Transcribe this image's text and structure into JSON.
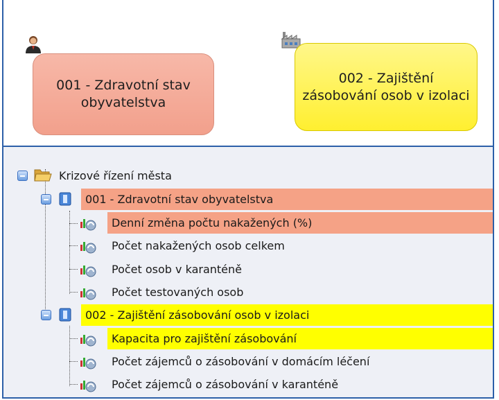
{
  "cards": [
    {
      "label": "001 - Zdravotní stav obyvatelstva",
      "color": "#f4a894"
    },
    {
      "label": "002 - Zajištění zásobování osob v izolaci",
      "color": "#fff44a"
    }
  ],
  "tree": {
    "root_label": "Krizové řízení města",
    "groups": [
      {
        "label": "001 - Zdravotní stav obyvatelstva",
        "highlight": "#f5a286",
        "items": [
          {
            "label": "Denní změna počtu nakažených (%)",
            "highlighted": true
          },
          {
            "label": "Počet nakažených osob celkem",
            "highlighted": false
          },
          {
            "label": "Počet osob v karanténě",
            "highlighted": false
          },
          {
            "label": "Počet testovaných osob",
            "highlighted": false
          }
        ]
      },
      {
        "label": "002 - Zajištění zásobování osob v izolaci",
        "highlight": "#ffff00",
        "items": [
          {
            "label": "Kapacita pro zajištění zásobování",
            "highlighted": true
          },
          {
            "label": "Počet zájemců o zásobování v domácím léčení",
            "highlighted": false
          },
          {
            "label": "Počet zájemců o zásobování v karanténě",
            "highlighted": false
          }
        ]
      }
    ]
  },
  "icons": {
    "person": "person-icon",
    "factory": "factory-icon",
    "folder": "folder-icon",
    "group_node": "group-node-icon",
    "kpi": "kpi-gauge-icon",
    "collapse": "collapse-icon"
  }
}
